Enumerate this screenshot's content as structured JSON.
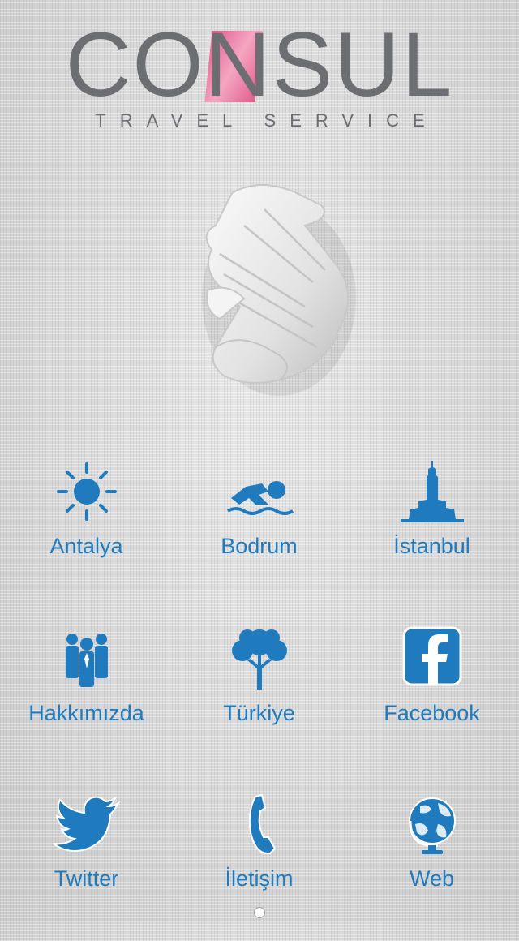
{
  "logo": {
    "word_prefix": "CO",
    "word_n": "N",
    "word_suffix": "SUL",
    "tagline": "TRAVEL SERVICE"
  },
  "colors": {
    "accent_blue": "#1f7bbd",
    "logo_gray": "#6d6e72",
    "logo_pink": "#e35b8c"
  },
  "menu": [
    {
      "label": "Antalya",
      "icon": "sun-icon"
    },
    {
      "label": "Bodrum",
      "icon": "swimmer-icon"
    },
    {
      "label": "İstanbul",
      "icon": "maiden-tower-icon"
    },
    {
      "label": "Hakkımızda",
      "icon": "people-icon"
    },
    {
      "label": "Türkiye",
      "icon": "tree-icon"
    },
    {
      "label": "Facebook",
      "icon": "facebook-icon"
    },
    {
      "label": "Twitter",
      "icon": "twitter-bird-icon"
    },
    {
      "label": "İletişim",
      "icon": "phone-icon"
    },
    {
      "label": "Web",
      "icon": "globe-icon"
    }
  ]
}
